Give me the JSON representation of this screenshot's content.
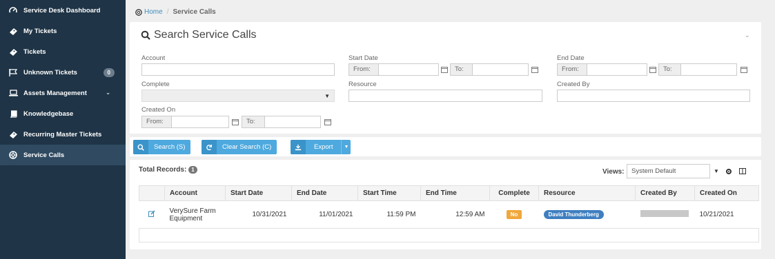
{
  "sidebar": {
    "items": [
      {
        "label": "Service Desk Dashboard",
        "icon": "dashboard-icon"
      },
      {
        "label": "My Tickets",
        "icon": "ticket-icon"
      },
      {
        "label": "Tickets",
        "icon": "ticket-icon"
      },
      {
        "label": "Unknown Tickets",
        "icon": "flag-icon",
        "badge": "0"
      },
      {
        "label": "Assets Management",
        "icon": "laptop-icon",
        "chevron": "chevron-down-icon"
      },
      {
        "label": "Knowledgebase",
        "icon": "book-icon"
      },
      {
        "label": "Recurring Master Tickets",
        "icon": "ticket-icon"
      },
      {
        "label": "Service Calls",
        "icon": "lifebuoy-icon",
        "active": true
      }
    ]
  },
  "breadcrumb": {
    "home": "Home",
    "separator": "/",
    "current": "Service Calls"
  },
  "search": {
    "title": "Search Service Calls",
    "fields": {
      "account_label": "Account",
      "start_date_label": "Start Date",
      "end_date_label": "End Date",
      "complete_label": "Complete",
      "resource_label": "Resource",
      "created_by_label": "Created By",
      "created_on_label": "Created On",
      "from_label": "From:",
      "to_label": "To:"
    }
  },
  "buttons": {
    "search": "Search (S)",
    "clear": "Clear Search (C)",
    "export": "Export"
  },
  "records": {
    "total_label": "Total Records:",
    "total": "1",
    "views_label": "Views:",
    "views_value": "System Default",
    "columns": [
      "Account",
      "Start Date",
      "End Date",
      "Start Time",
      "End Time",
      "Complete",
      "Resource",
      "Created By",
      "Created On"
    ],
    "rows": [
      {
        "account": "VerySure Farm Equipment",
        "start_date": "10/31/2021",
        "end_date": "11/01/2021",
        "start_time": "11:59 PM",
        "end_time": "12:59 AM",
        "complete": "No",
        "resource": "David Thunderberg",
        "created_on": "10/21/2021"
      }
    ]
  },
  "colors": {
    "sidebar_bg": "#1f3446",
    "accent": "#4ea9de",
    "warning": "#f0a73b",
    "resource_pill": "#3f7fc0"
  }
}
